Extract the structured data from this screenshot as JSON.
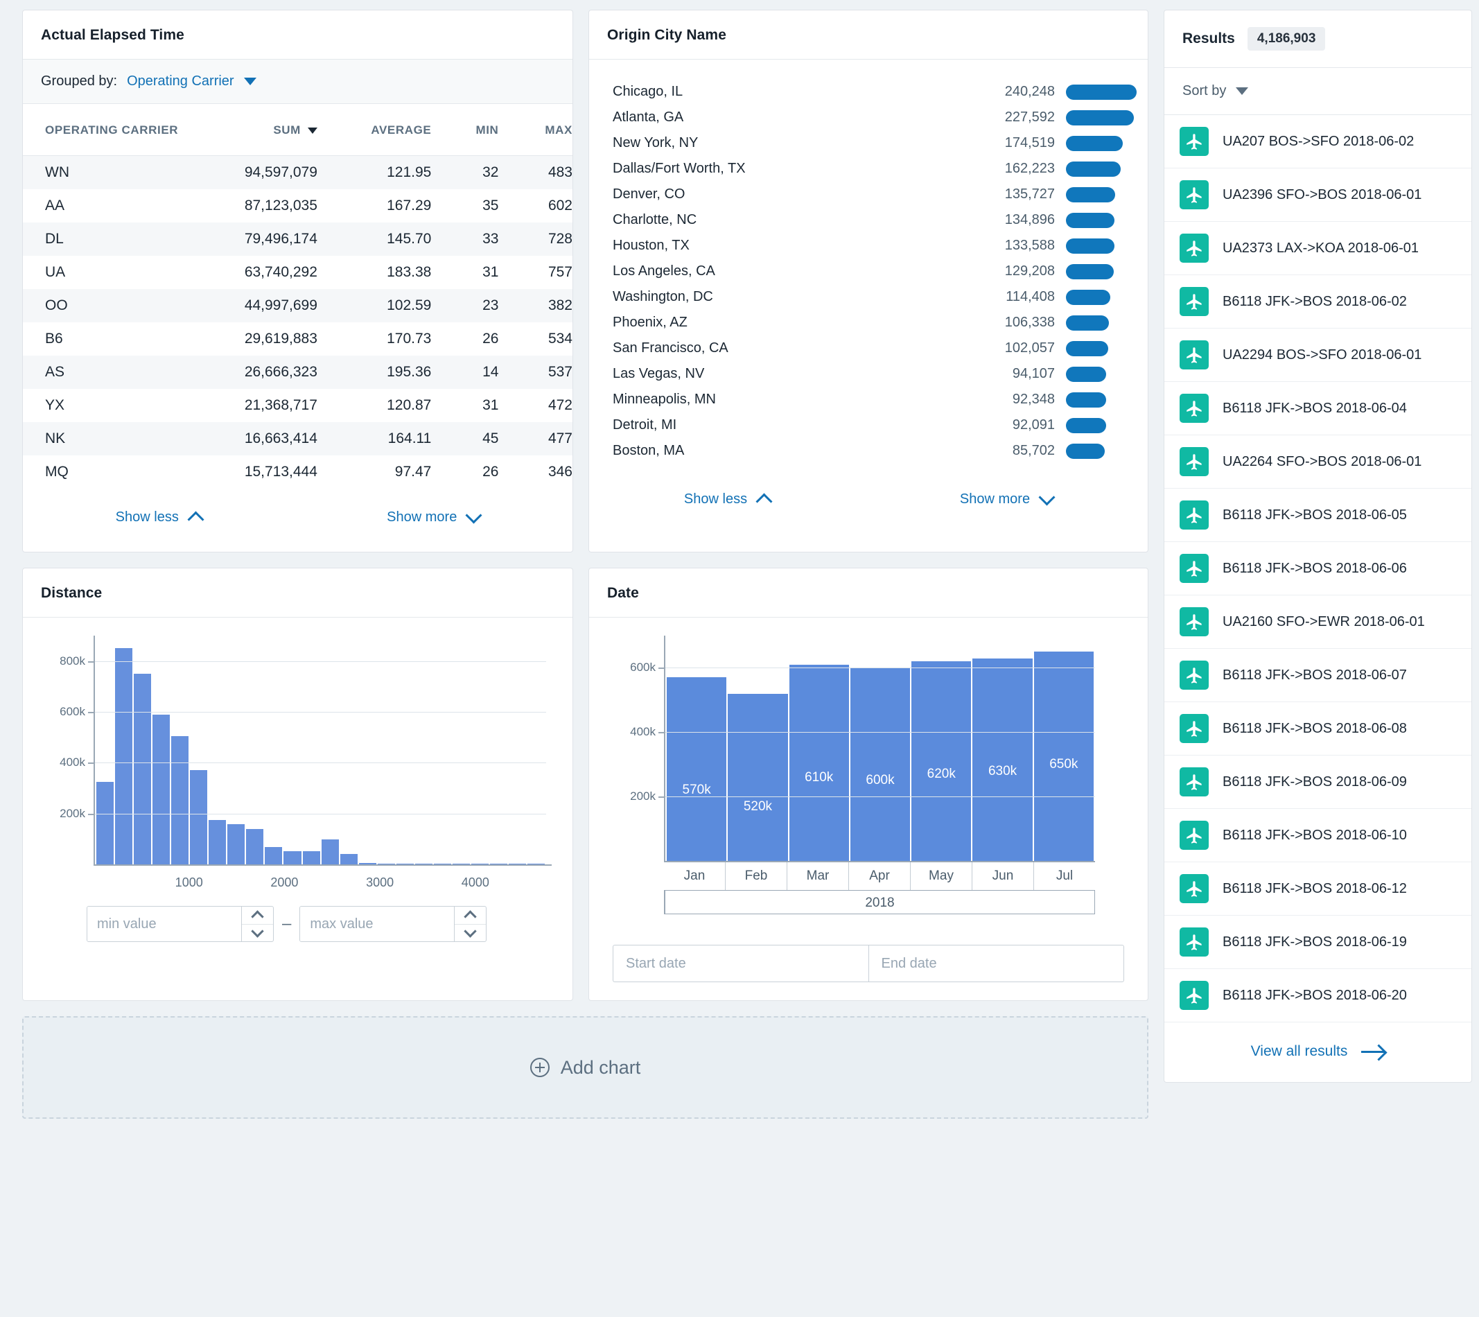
{
  "elapsed_panel": {
    "title": "Actual Elapsed Time",
    "grouped_by_label": "Grouped by:",
    "grouped_by_value": "Operating Carrier",
    "columns": [
      "OPERATING CARRIER",
      "SUM",
      "AVERAGE",
      "MIN",
      "MAX"
    ],
    "rows": [
      {
        "carrier": "WN",
        "sum": "94,597,079",
        "average": "121.95",
        "min": "32",
        "max": "483"
      },
      {
        "carrier": "AA",
        "sum": "87,123,035",
        "average": "167.29",
        "min": "35",
        "max": "602"
      },
      {
        "carrier": "DL",
        "sum": "79,496,174",
        "average": "145.70",
        "min": "33",
        "max": "728"
      },
      {
        "carrier": "UA",
        "sum": "63,740,292",
        "average": "183.38",
        "min": "31",
        "max": "757"
      },
      {
        "carrier": "OO",
        "sum": "44,997,699",
        "average": "102.59",
        "min": "23",
        "max": "382"
      },
      {
        "carrier": "B6",
        "sum": "29,619,883",
        "average": "170.73",
        "min": "26",
        "max": "534"
      },
      {
        "carrier": "AS",
        "sum": "26,666,323",
        "average": "195.36",
        "min": "14",
        "max": "537"
      },
      {
        "carrier": "YX",
        "sum": "21,368,717",
        "average": "120.87",
        "min": "31",
        "max": "472"
      },
      {
        "carrier": "NK",
        "sum": "16,663,414",
        "average": "164.11",
        "min": "45",
        "max": "477"
      },
      {
        "carrier": "MQ",
        "sum": "15,713,444",
        "average": "97.47",
        "min": "26",
        "max": "346"
      }
    ],
    "show_less": "Show less",
    "show_more": "Show more"
  },
  "city_panel": {
    "title": "Origin City Name",
    "show_less": "Show less",
    "show_more": "Show more",
    "rows": [
      {
        "name": "Chicago, IL",
        "value": "240,248",
        "num": 240248
      },
      {
        "name": "Atlanta, GA",
        "value": "227,592",
        "num": 227592
      },
      {
        "name": "New York, NY",
        "value": "174,519",
        "num": 174519
      },
      {
        "name": "Dallas/Fort Worth, TX",
        "value": "162,223",
        "num": 162223
      },
      {
        "name": "Denver, CO",
        "value": "135,727",
        "num": 135727
      },
      {
        "name": "Charlotte, NC",
        "value": "134,896",
        "num": 134896
      },
      {
        "name": "Houston, TX",
        "value": "133,588",
        "num": 133588
      },
      {
        "name": "Los Angeles, CA",
        "value": "129,208",
        "num": 129208
      },
      {
        "name": "Washington, DC",
        "value": "114,408",
        "num": 114408
      },
      {
        "name": "Phoenix, AZ",
        "value": "106,338",
        "num": 106338
      },
      {
        "name": "San Francisco, CA",
        "value": "102,057",
        "num": 102057
      },
      {
        "name": "Las Vegas, NV",
        "value": "94,107",
        "num": 94107
      },
      {
        "name": "Minneapolis, MN",
        "value": "92,348",
        "num": 92348
      },
      {
        "name": "Detroit, MI",
        "value": "92,091",
        "num": 92091
      },
      {
        "name": "Boston, MA",
        "value": "85,702",
        "num": 85702
      }
    ]
  },
  "distance_panel": {
    "title": "Distance",
    "min_placeholder": "min value",
    "max_placeholder": "max value",
    "min_value": "",
    "max_value": "",
    "separator": "–"
  },
  "date_panel": {
    "title": "Date",
    "start_placeholder": "Start date",
    "end_placeholder": "End date",
    "start_value": "",
    "end_value": "",
    "year_label": "2018"
  },
  "add_chart": {
    "label": "Add chart"
  },
  "results_panel": {
    "title": "Results",
    "count": "4,186,903",
    "sort_by": "Sort by",
    "view_all": "View all results",
    "items": [
      "UA207 BOS->SFO 2018-06-02",
      "UA2396 SFO->BOS 2018-06-01",
      "UA2373 LAX->KOA 2018-06-01",
      "B6118 JFK->BOS 2018-06-02",
      "UA2294 BOS->SFO 2018-06-01",
      "B6118 JFK->BOS 2018-06-04",
      "UA2264 SFO->BOS 2018-06-01",
      "B6118 JFK->BOS 2018-06-05",
      "B6118 JFK->BOS 2018-06-06",
      "UA2160 SFO->EWR 2018-06-01",
      "B6118 JFK->BOS 2018-06-07",
      "B6118 JFK->BOS 2018-06-08",
      "B6118 JFK->BOS 2018-06-09",
      "B6118 JFK->BOS 2018-06-10",
      "B6118 JFK->BOS 2018-06-12",
      "B6118 JFK->BOS 2018-06-19",
      "B6118 JFK->BOS 2018-06-20"
    ]
  },
  "colors": {
    "accent_blue": "#1271b5",
    "bar_blue": "#1077bc",
    "chart_blue": "#5b8bdc",
    "badge_teal": "#10b9a3",
    "page_bg": "#eef2f5"
  },
  "chart_data": [
    {
      "type": "bar",
      "id": "distance-histogram",
      "title": "Distance",
      "xlabel": "",
      "ylabel": "",
      "xlim": [
        0,
        4800
      ],
      "ylim": [
        0,
        900000
      ],
      "grid": true,
      "ytick_labels": [
        "200k",
        "400k",
        "600k",
        "800k"
      ],
      "ytick_values": [
        200000,
        400000,
        600000,
        800000
      ],
      "xtick_labels": [
        "1000",
        "2000",
        "3000",
        "4000"
      ],
      "xtick_values": [
        1000,
        2000,
        3000,
        4000
      ],
      "bin_width": 200,
      "x": [
        100,
        300,
        500,
        700,
        900,
        1100,
        1300,
        1500,
        1700,
        1900,
        2100,
        2300,
        2500,
        2700,
        2900,
        3100,
        3300,
        3500,
        3700,
        3900,
        4100,
        4300,
        4500,
        4700
      ],
      "values": [
        325000,
        850000,
        750000,
        590000,
        505000,
        370000,
        175000,
        158000,
        138000,
        68000,
        52000,
        53000,
        98000,
        42000,
        5000,
        1000,
        800,
        700,
        600,
        3000,
        500,
        400,
        300,
        200
      ]
    },
    {
      "type": "bar",
      "id": "date-by-month",
      "title": "Date",
      "xlabel": "2018",
      "ylabel": "",
      "ylim": [
        0,
        700000
      ],
      "grid": true,
      "ytick_labels": [
        "200k",
        "400k",
        "600k"
      ],
      "ytick_values": [
        200000,
        400000,
        600000
      ],
      "categories": [
        "Jan",
        "Feb",
        "Mar",
        "Apr",
        "May",
        "Jun",
        "Jul"
      ],
      "values": [
        570000,
        520000,
        610000,
        600000,
        620000,
        630000,
        650000
      ],
      "data_labels": [
        "570k",
        "520k",
        "610k",
        "600k",
        "620k",
        "630k",
        "650k"
      ]
    },
    {
      "type": "bar",
      "id": "origin-city-name",
      "title": "Origin City Name",
      "orientation": "horizontal",
      "categories": [
        "Chicago, IL",
        "Atlanta, GA",
        "New York, NY",
        "Dallas/Fort Worth, TX",
        "Denver, CO",
        "Charlotte, NC",
        "Houston, TX",
        "Los Angeles, CA",
        "Washington, DC",
        "Phoenix, AZ",
        "San Francisco, CA",
        "Las Vegas, NV",
        "Minneapolis, MN",
        "Detroit, MI",
        "Boston, MA"
      ],
      "values": [
        240248,
        227592,
        174519,
        162223,
        135727,
        134896,
        133588,
        129208,
        114408,
        106338,
        102057,
        94107,
        92348,
        92091,
        85702
      ]
    },
    {
      "type": "table",
      "id": "actual-elapsed-time",
      "title": "Actual Elapsed Time",
      "columns": [
        "OPERATING CARRIER",
        "SUM",
        "AVERAGE",
        "MIN",
        "MAX"
      ],
      "rows": [
        [
          "WN",
          94597079,
          121.95,
          32,
          483
        ],
        [
          "AA",
          87123035,
          167.29,
          35,
          602
        ],
        [
          "DL",
          79496174,
          145.7,
          33,
          728
        ],
        [
          "UA",
          63740292,
          183.38,
          31,
          757
        ],
        [
          "OO",
          44997699,
          102.59,
          23,
          382
        ],
        [
          "B6",
          29619883,
          170.73,
          26,
          534
        ],
        [
          "AS",
          26666323,
          195.36,
          14,
          537
        ],
        [
          "YX",
          21368717,
          120.87,
          31,
          472
        ],
        [
          "NK",
          16663414,
          164.11,
          45,
          477
        ],
        [
          "MQ",
          15713444,
          97.47,
          26,
          346
        ]
      ]
    }
  ]
}
